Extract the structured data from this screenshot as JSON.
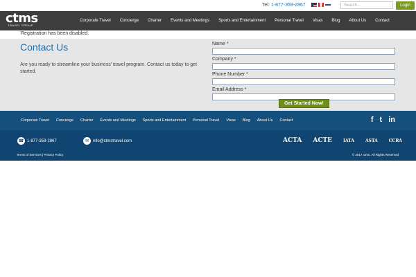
{
  "topbar": {
    "tel_label": "Tel:",
    "tel_number": "1-877-359-2867",
    "search_placeholder": "Search...",
    "login_label": "Login"
  },
  "header": {
    "logo_text": "ctms",
    "logo_subtext": "TRAVEL GROUP",
    "nav": [
      "Corporate Travel",
      "Concierge",
      "Charter",
      "Events and Meetings",
      "Sports and Entertainment",
      "Personal Travel",
      "Visas",
      "Blog",
      "About Us",
      "Contact"
    ]
  },
  "notice": "Registration has been disabled.",
  "contact": {
    "title": "Contact Us",
    "description": "Are you ready to streamline your business' travel program. Contact us today to get started.",
    "fields": {
      "name": "Name *",
      "company": "Company *",
      "phone": "Phone Number *",
      "email": "Email Address *"
    },
    "submit_label": "Get Started Now!"
  },
  "footer": {
    "nav": [
      "Corporate Travel",
      "Concierge",
      "Charter",
      "Events and Meetings",
      "Sports and Entertainment",
      "Personal Travel",
      "Visas",
      "Blog",
      "About Us",
      "Contact"
    ],
    "social": {
      "facebook": "f",
      "twitter": "t",
      "linkedin": "in"
    },
    "phone": "1-877-359-2867",
    "email": "info@ctmstravel.com",
    "partner_logos": [
      "ACTA",
      "ACTE",
      "IATA",
      "ASTA",
      "CCRA"
    ],
    "legal": "Terms of Services | Privacy Policy",
    "copyright": "© 2017 ctms. All Rights Reserved"
  }
}
